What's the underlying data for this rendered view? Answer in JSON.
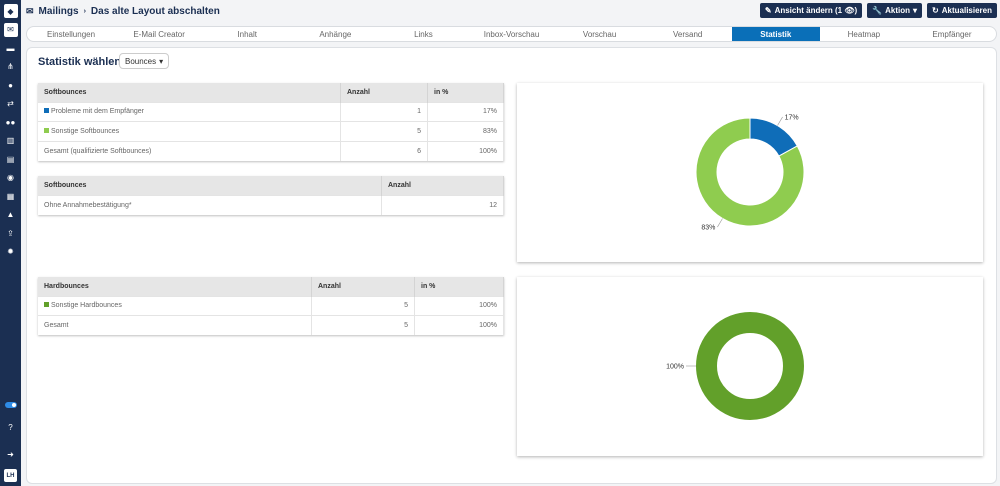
{
  "header": {
    "section": "Mailings",
    "page": "Das alte Layout abschalten"
  },
  "buttons": {
    "view": "Ansicht ändern (1 👁)",
    "action": "Aktion",
    "refresh": "Aktualisieren"
  },
  "tabs": [
    "Einstellungen",
    "E-Mail Creator",
    "Inhalt",
    "Anhänge",
    "Links",
    "Inbox-Vorschau",
    "Vorschau",
    "Versand",
    "Statistik",
    "Heatmap",
    "Empfänger"
  ],
  "active_tab": "Statistik",
  "stat": {
    "title": "Statistik wählen",
    "selected": "Bounces"
  },
  "sidebar": {
    "avatar": "LH"
  },
  "table1": {
    "headers": [
      "Softbounces",
      "Anzahl",
      "in %"
    ],
    "rows": [
      [
        "Probleme mit dem Empfänger",
        "1",
        "17%"
      ],
      [
        "Sonstige Softbounces",
        "5",
        "83%"
      ],
      [
        "Gesamt (qualifizierte Softbounces)",
        "6",
        "100%"
      ]
    ]
  },
  "table2": {
    "headers": [
      "Softbounces",
      "Anzahl"
    ],
    "rows": [
      [
        "Ohne Annahmebestätigung*",
        "12"
      ]
    ]
  },
  "table3": {
    "headers": [
      "Hardbounces",
      "Anzahl",
      "in %"
    ],
    "rows": [
      [
        "Sonstige Hardbounces",
        "5",
        "100%"
      ],
      [
        "Gesamt",
        "5",
        "100%"
      ]
    ]
  },
  "colors": {
    "blue": "#0f6db8",
    "lightgreen": "#8fcc4f",
    "darkgreen": "#62a02a",
    "navy": "#1b2f52"
  },
  "chart_data": [
    {
      "type": "pie",
      "title": "Softbounces",
      "categories": [
        "Probleme mit dem Empfänger",
        "Sonstige Softbounces"
      ],
      "values": [
        17,
        83
      ],
      "labels": [
        "17%",
        "83%"
      ],
      "colors": [
        "#0f6db8",
        "#8fcc4f"
      ]
    },
    {
      "type": "pie",
      "title": "Hardbounces",
      "categories": [
        "Sonstige Hardbounces"
      ],
      "values": [
        100
      ],
      "labels": [
        "100%"
      ],
      "colors": [
        "#62a02a"
      ]
    }
  ]
}
